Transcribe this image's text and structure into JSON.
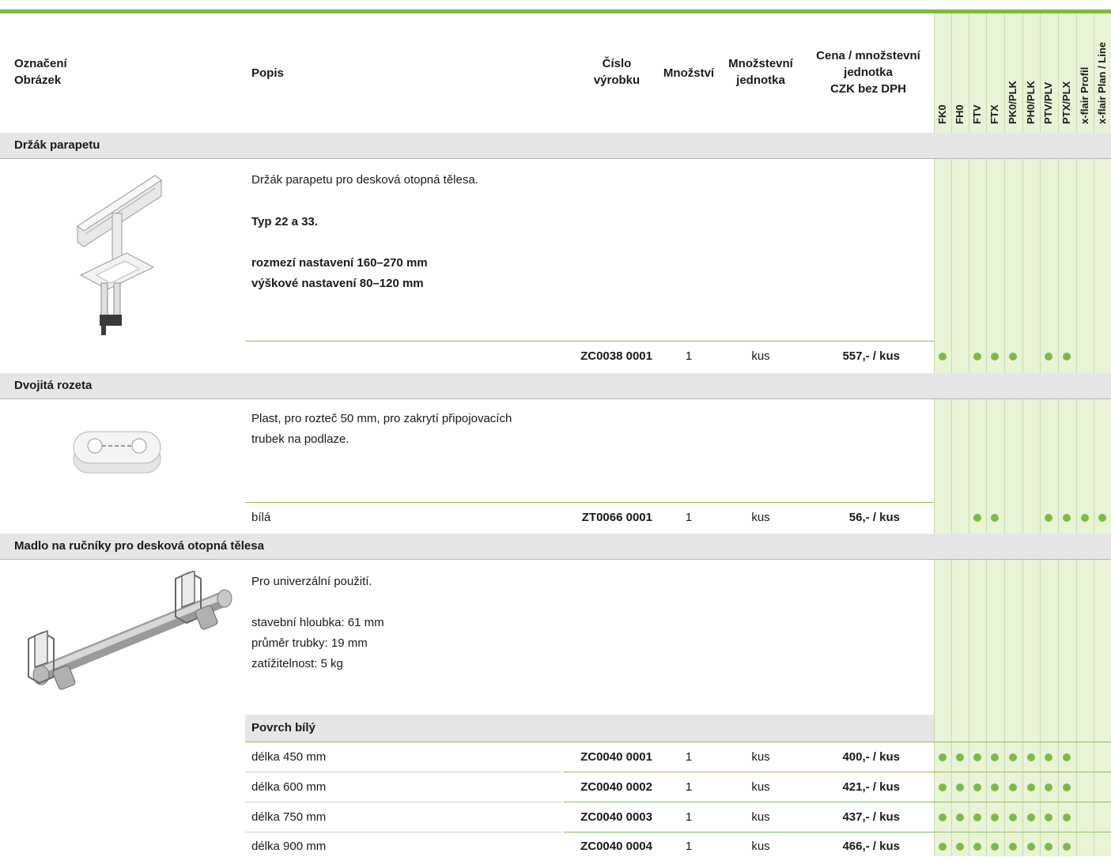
{
  "header": {
    "label1": "Označení",
    "label2": "Obrázek",
    "popis": "Popis",
    "cislo1": "Číslo",
    "cislo2": "výrobku",
    "mnozstvi": "Množství",
    "jed1": "Množstevní",
    "jed2": "jednotka",
    "cena1": "Cena / množstevní",
    "cena2": "jednotka",
    "cena3": "CZK bez DPH",
    "models": [
      "FK0",
      "FH0",
      "FTV",
      "FTX",
      "PK0/PLK",
      "PH0/PLK",
      "PTV/PLV",
      "PTX/PLX",
      "x-flair Profil",
      "x-flair Plan / Line"
    ]
  },
  "sections": [
    {
      "title": "Držák parapetu",
      "image": "parapet-bracket-image",
      "desc_lines": [
        {
          "text": "Držák parapetu pro desková otopná tělesa.",
          "bold": false
        },
        {
          "text": "Typ 22 a 33.",
          "bold": true
        },
        {
          "text": "rozmezí nastavení 160–270 mm",
          "bold": true
        },
        {
          "text": "výškové nastavení 80–120 mm",
          "bold": true
        }
      ],
      "rows": [
        {
          "desc": "",
          "code": "ZC0038 0001",
          "qty": "1",
          "unit": "kus",
          "price": "557,- / kus",
          "dots": [
            1,
            0,
            1,
            1,
            1,
            0,
            1,
            1,
            0,
            0
          ]
        }
      ]
    },
    {
      "title": "Dvojitá rozeta",
      "image": "double-rosette-image",
      "desc_lines": [
        {
          "text": "Plast, pro rozteč 50 mm, pro zakrytí připojovacích",
          "bold": false
        },
        {
          "text": "trubek na podlaze.",
          "bold": false
        }
      ],
      "rows": [
        {
          "desc": "bílá",
          "code": "ZT0066 0001",
          "qty": "1",
          "unit": "kus",
          "price": "56,- / kus",
          "dots": [
            0,
            0,
            1,
            1,
            0,
            0,
            1,
            1,
            1,
            1
          ]
        }
      ]
    },
    {
      "title": "Madlo na ručníky pro desková otopná tělesa",
      "image": "towel-rail-image",
      "desc_lines": [
        {
          "text": "Pro univerzální použití.",
          "bold": false
        },
        {
          "text": "stavební hloubka: 61 mm",
          "bold": false
        },
        {
          "text": "průměr trubky: 19 mm",
          "bold": false
        },
        {
          "text": "zatížitelnost: 5 kg",
          "bold": false
        }
      ],
      "subheader": "Povrch bílý",
      "rows": [
        {
          "desc": "délka 450 mm",
          "code": "ZC0040 0001",
          "qty": "1",
          "unit": "kus",
          "price": "400,- / kus",
          "dots": [
            1,
            1,
            1,
            1,
            1,
            1,
            1,
            1,
            0,
            0
          ]
        },
        {
          "desc": "délka 600 mm",
          "code": "ZC0040 0002",
          "qty": "1",
          "unit": "kus",
          "price": "421,- / kus",
          "dots": [
            1,
            1,
            1,
            1,
            1,
            1,
            1,
            1,
            0,
            0
          ]
        },
        {
          "desc": "délka 750 mm",
          "code": "ZC0040 0003",
          "qty": "1",
          "unit": "kus",
          "price": "437,- / kus",
          "dots": [
            1,
            1,
            1,
            1,
            1,
            1,
            1,
            1,
            0,
            0
          ]
        },
        {
          "desc": "délka 900 mm",
          "code": "ZC0040 0004",
          "qty": "1",
          "unit": "kus",
          "price": "466,- / kus",
          "dots": [
            1,
            1,
            1,
            1,
            1,
            1,
            1,
            1,
            0,
            0
          ]
        }
      ]
    }
  ],
  "colors": {
    "accent": "#7dbb42",
    "compat_bg": "#e9f3d7",
    "section_bg": "#e6e6e6"
  }
}
